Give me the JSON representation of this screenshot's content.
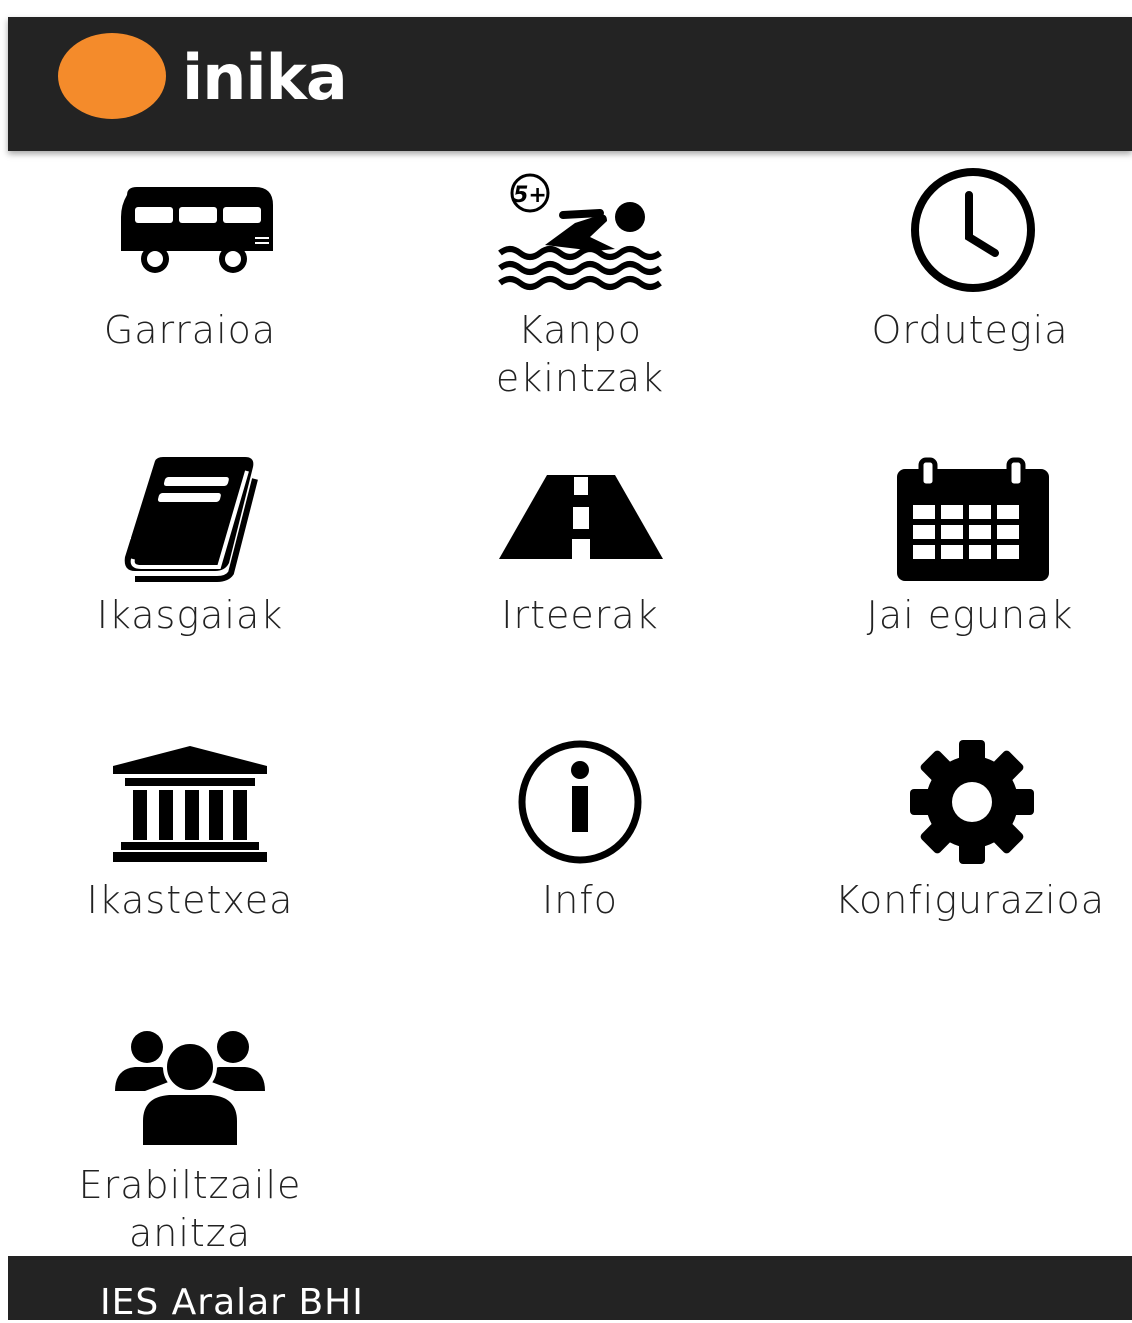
{
  "header": {
    "logo_text": "inika",
    "brand_color": "#f48b2b",
    "background": "#232323"
  },
  "menu": {
    "items": [
      {
        "label": "Garraioa",
        "icon": "bus-icon"
      },
      {
        "label": "Kanpo\nekintzak",
        "icon": "swimmer-icon"
      },
      {
        "label": "Ordutegia",
        "icon": "clock-icon"
      },
      {
        "label": "Ikasgaiak",
        "icon": "book-icon"
      },
      {
        "label": "Irteerak",
        "icon": "road-icon"
      },
      {
        "label": "Jai egunak",
        "icon": "calendar-icon"
      },
      {
        "label": "Ikastetxea",
        "icon": "building-icon"
      },
      {
        "label": "Info",
        "icon": "info-icon"
      },
      {
        "label": "Konfigurazioa",
        "icon": "gear-icon"
      },
      {
        "label": "Erabiltzaile\nanitza",
        "icon": "users-icon"
      }
    ]
  },
  "footer": {
    "school_name": "IES Aralar BHI"
  }
}
